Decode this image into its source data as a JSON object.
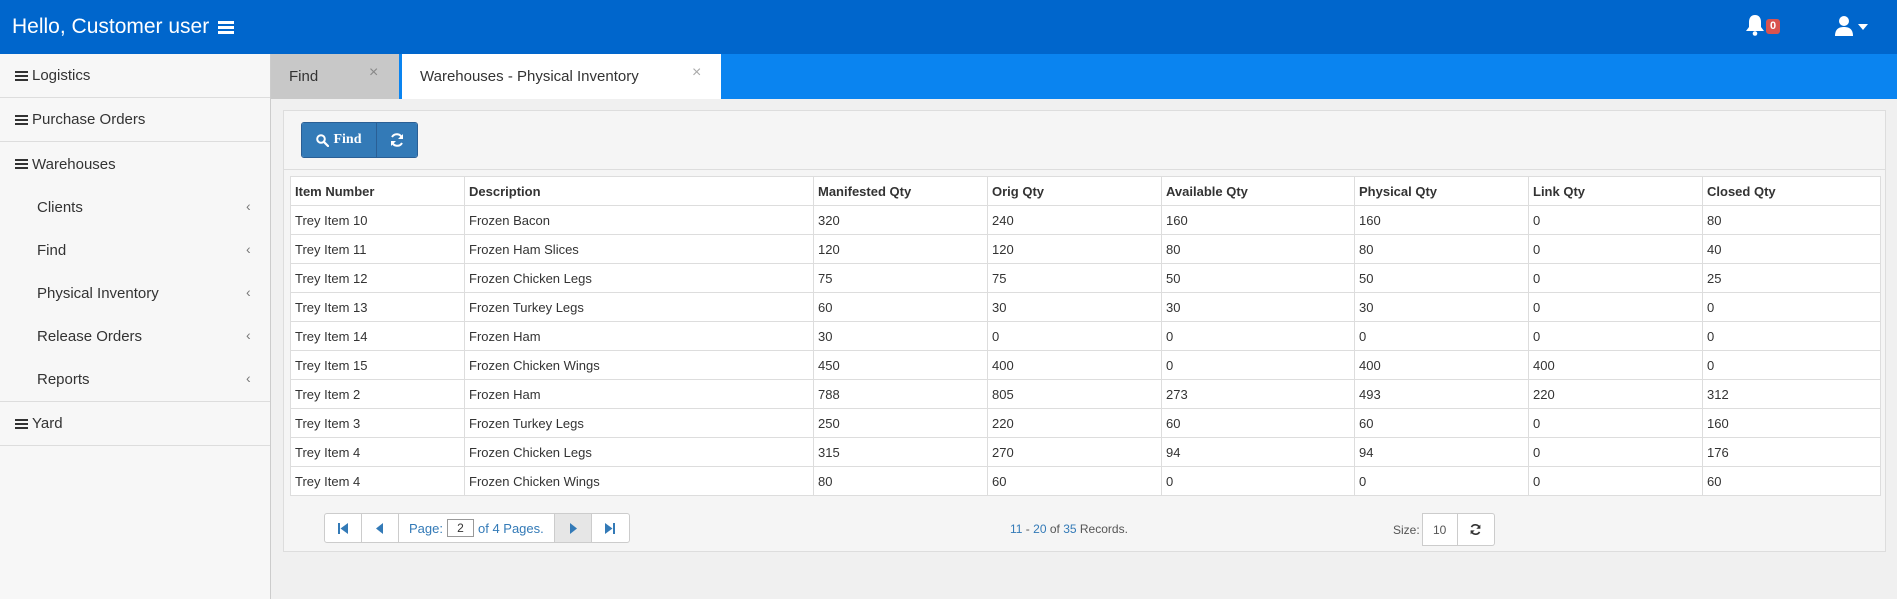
{
  "header": {
    "greeting": "Hello, Customer user",
    "notification_count": "0"
  },
  "sidebar": {
    "sections": [
      {
        "label": "Logistics"
      },
      {
        "label": "Purchase Orders"
      },
      {
        "label": "Warehouses"
      },
      {
        "label": "Yard"
      }
    ],
    "warehouse_items": [
      {
        "label": "Clients"
      },
      {
        "label": "Find"
      },
      {
        "label": "Physical Inventory"
      },
      {
        "label": "Release Orders"
      },
      {
        "label": "Reports"
      }
    ]
  },
  "tabs": [
    {
      "label": "Find",
      "close": "×"
    },
    {
      "label": "Warehouses - Physical Inventory",
      "close": "×"
    }
  ],
  "toolbar": {
    "find_label": "Find"
  },
  "table": {
    "columns": [
      "Item Number",
      "Description",
      "Manifested Qty",
      "Orig Qty",
      "Available Qty",
      "Physical Qty",
      "Link Qty",
      "Closed Qty"
    ],
    "rows": [
      [
        "Trey Item 10",
        "Frozen Bacon",
        "320",
        "240",
        "160",
        "160",
        "0",
        "80"
      ],
      [
        "Trey Item 11",
        "Frozen Ham Slices",
        "120",
        "120",
        "80",
        "80",
        "0",
        "40"
      ],
      [
        "Trey Item 12",
        "Frozen Chicken Legs",
        "75",
        "75",
        "50",
        "50",
        "0",
        "25"
      ],
      [
        "Trey Item 13",
        "Frozen Turkey Legs",
        "60",
        "30",
        "30",
        "30",
        "0",
        "0"
      ],
      [
        "Trey Item 14",
        "Frozen Ham",
        "30",
        "0",
        "0",
        "0",
        "0",
        "0"
      ],
      [
        "Trey Item 15",
        "Frozen Chicken Wings",
        "450",
        "400",
        "0",
        "400",
        "400",
        "0"
      ],
      [
        "Trey Item 2",
        "Frozen Ham",
        "788",
        "805",
        "273",
        "493",
        "220",
        "312"
      ],
      [
        "Trey Item 3",
        "Frozen Turkey Legs",
        "250",
        "220",
        "60",
        "60",
        "0",
        "160"
      ],
      [
        "Trey Item 4",
        "Frozen Chicken Legs",
        "315",
        "270",
        "94",
        "94",
        "0",
        "176"
      ],
      [
        "Trey Item 4",
        "Frozen Chicken Wings",
        "80",
        "60",
        "0",
        "0",
        "0",
        "60"
      ]
    ]
  },
  "pager": {
    "page_prefix": "Page:",
    "current_page": "2",
    "page_suffix": "of 4 Pages.",
    "range_start": "11",
    "range_sep": " - ",
    "range_end": "20",
    "of_text": " of ",
    "total": "35",
    "records_suffix": " Records.",
    "size_label": "Size:",
    "size_value": "10"
  }
}
